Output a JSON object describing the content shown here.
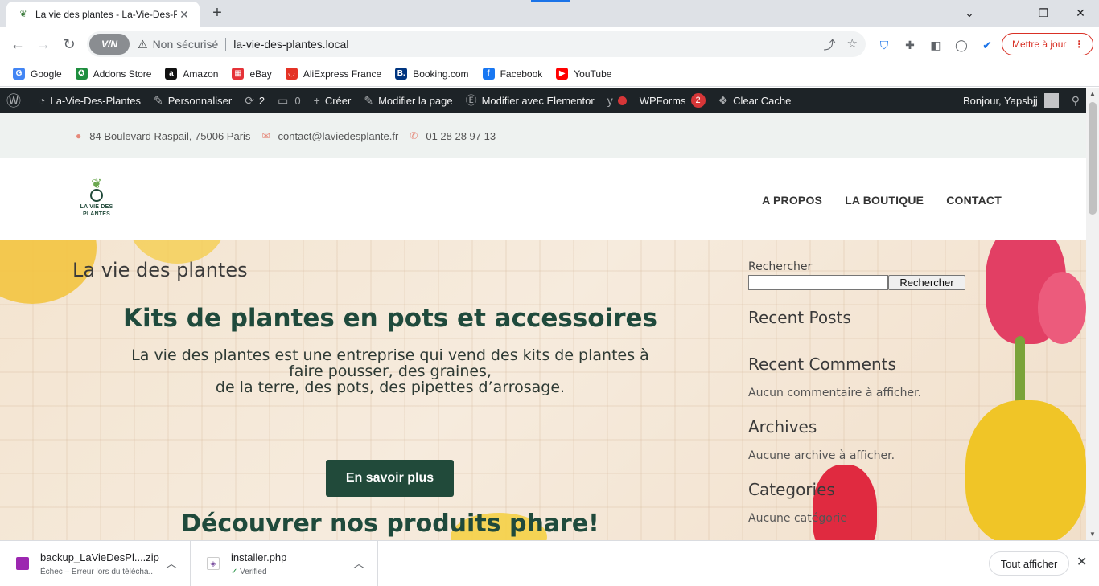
{
  "browser": {
    "tab_title": "La vie des plantes - La-Vie-Des-P",
    "address": {
      "insecure_label": "Non sécurisé",
      "url": "la-vie-des-plantes.local",
      "vpn_label": "V/N"
    },
    "update_button": "Mettre à jour",
    "bookmarks": [
      {
        "label": "Google",
        "icon": "google-icon",
        "color": "#4285f4"
      },
      {
        "label": "Addons Store",
        "icon": "addons-store-icon",
        "color": "#1e8e3e"
      },
      {
        "label": "Amazon",
        "icon": "amazon-icon",
        "color": "#111111"
      },
      {
        "label": "eBay",
        "icon": "ebay-icon",
        "color": "#e53238"
      },
      {
        "label": "AliExpress France",
        "icon": "aliexpress-icon",
        "color": "#e43225"
      },
      {
        "label": "Booking.com",
        "icon": "booking-icon",
        "color": "#003580"
      },
      {
        "label": "Facebook",
        "icon": "facebook-icon",
        "color": "#1877f2"
      },
      {
        "label": "YouTube",
        "icon": "youtube-icon",
        "color": "#ff0000"
      }
    ]
  },
  "wp_admin_bar": {
    "site_name": "La-Vie-Des-Plantes",
    "customize": "Personnaliser",
    "updates_count": "2",
    "comments_count": "0",
    "new": "Créer",
    "edit_page": "Modifier la page",
    "edit_elementor": "Modifier avec Elementor",
    "wpforms": "WPForms",
    "wpforms_badge": "2",
    "clear_cache": "Clear Cache",
    "greeting": "Bonjour, Yapsbjj"
  },
  "site": {
    "topbar": {
      "address": "84 Boulevard Raspail, 75006 Paris",
      "email": "contact@laviedesplante.fr",
      "phone": "01 28 28 97 13"
    },
    "logo_text_line1": "LA VIE DES",
    "logo_text_line2": "PLANTES",
    "nav": [
      "A PROPOS",
      "LA BOUTIQUE",
      "CONTACT"
    ],
    "hero": {
      "site_title": "La vie des plantes",
      "heading": "Kits de plantes en pots et accessoires",
      "text_line1": "La vie des plantes est une entreprise qui vend des kits de plantes à faire pousser, des graines,",
      "text_line2": "de la terre, des pots, des pipettes d’arrosage.",
      "cta": "En savoir plus",
      "discover": "Découvrer nos produits phare!"
    },
    "sidebar": {
      "search_label": "Rechercher",
      "search_button": "Rechercher",
      "search_value": "",
      "recent_posts": "Recent Posts",
      "recent_comments": "Recent Comments",
      "no_comments": "Aucun commentaire à afficher.",
      "archives": "Archives",
      "no_archives": "Aucune archive à afficher.",
      "categories": "Categories",
      "no_categories": "Aucune catégorie"
    }
  },
  "downloads": [
    {
      "name": "backup_LaVieDesPl....zip",
      "status": "Échec – Erreur lors du télécha..."
    },
    {
      "name": "installer.php",
      "status": "Verified"
    }
  ],
  "downloads_show_all": "Tout afficher"
}
